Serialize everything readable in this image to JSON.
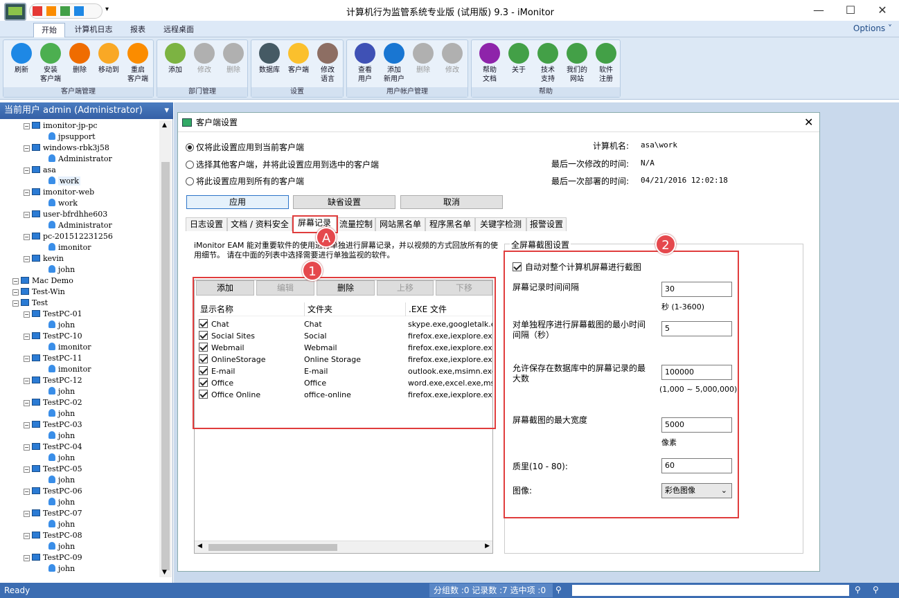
{
  "window": {
    "title": "计算机行为监管系统专业版 (试用版) 9.3 - iMonitor",
    "minimize": "—",
    "maximize": "☐",
    "close": "✕"
  },
  "ribbon_tabs": [
    "开始",
    "计算机日志",
    "报表",
    "远程桌面"
  ],
  "options_label": "Options ˅",
  "groups": [
    {
      "title": "客户端管理",
      "buttons": [
        {
          "label": "刷新",
          "icon": "refresh-icon",
          "color": "#1e88e5"
        },
        {
          "label": "安装\n客户端",
          "icon": "install-client-icon",
          "color": "#4caf50"
        },
        {
          "label": "删除",
          "icon": "delete-x-icon",
          "color": "#ef6c00"
        },
        {
          "label": "移动到",
          "icon": "move-folder-icon",
          "color": "#f9a825"
        },
        {
          "label": "重启\n客户端",
          "icon": "restart-icon",
          "color": "#fb8c00"
        }
      ]
    },
    {
      "title": "部门管理",
      "buttons": [
        {
          "label": "添加",
          "icon": "add-plus-icon",
          "color": "#7cb342"
        },
        {
          "label": "修改",
          "icon": "edit-icon",
          "color": "#b0b0b0",
          "disabled": true
        },
        {
          "label": "删除",
          "icon": "delete-x-icon",
          "color": "#b0b0b0",
          "disabled": true
        }
      ]
    },
    {
      "title": "设置",
      "buttons": [
        {
          "label": "数据库",
          "icon": "database-icon",
          "color": "#455a64"
        },
        {
          "label": "客户端",
          "icon": "client-settings-icon",
          "color": "#fbc02d"
        },
        {
          "label": "修改\n语言",
          "icon": "language-icon",
          "color": "#8d6e63"
        }
      ]
    },
    {
      "title": "用户帐户管理",
      "buttons": [
        {
          "label": "查看\n用户",
          "icon": "view-users-icon",
          "color": "#3f51b5"
        },
        {
          "label": "添加\n新用户",
          "icon": "add-user-icon",
          "color": "#1976d2"
        },
        {
          "label": "删除",
          "icon": "delete-user-icon",
          "color": "#b0b0b0",
          "disabled": true
        },
        {
          "label": "修改",
          "icon": "edit-user-icon",
          "color": "#b0b0b0",
          "disabled": true
        }
      ]
    },
    {
      "title": "帮助",
      "buttons": [
        {
          "label": "帮助\n文档",
          "icon": "help-icon",
          "color": "#8e24aa"
        },
        {
          "label": "关于",
          "icon": "about-icon",
          "color": "#43a047"
        },
        {
          "label": "技术\n支持",
          "icon": "support-icon",
          "color": "#43a047"
        },
        {
          "label": "我们的\n网站",
          "icon": "website-icon",
          "color": "#43a047"
        },
        {
          "label": "软件\n注册",
          "icon": "register-icon",
          "color": "#43a047"
        }
      ]
    }
  ],
  "left_pane": {
    "header": "当前用户 admin (Administrator)",
    "tree": [
      {
        "label": "imonitor-jp-pc",
        "type": "pc",
        "level": 1
      },
      {
        "label": "jpsupport",
        "type": "user",
        "level": 2
      },
      {
        "label": "windows-rbk3j58",
        "type": "pc",
        "level": 1
      },
      {
        "label": "Administrator",
        "type": "user",
        "level": 2
      },
      {
        "label": "asa",
        "type": "pc",
        "level": 1
      },
      {
        "label": "work",
        "type": "user",
        "level": 2,
        "selected": true
      },
      {
        "label": "imonitor-web",
        "type": "pc",
        "level": 1
      },
      {
        "label": "work",
        "type": "user",
        "level": 2
      },
      {
        "label": "user-bfrdhhe603",
        "type": "pc",
        "level": 1
      },
      {
        "label": "Administrator",
        "type": "user",
        "level": 2
      },
      {
        "label": "pc-201512231256",
        "type": "pc",
        "level": 1
      },
      {
        "label": "imonitor",
        "type": "user",
        "level": 2
      },
      {
        "label": "kevin",
        "type": "pc",
        "level": 1
      },
      {
        "label": "john",
        "type": "user",
        "level": 2
      },
      {
        "label": "Mac Demo",
        "type": "group",
        "level": 0
      },
      {
        "label": "Test-Win",
        "type": "group",
        "level": 0
      },
      {
        "label": "Test",
        "type": "group",
        "level": 0
      },
      {
        "label": "TestPC-01",
        "type": "pc",
        "level": 1
      },
      {
        "label": "john",
        "type": "user",
        "level": 2
      },
      {
        "label": "TestPC-10",
        "type": "pc",
        "level": 1
      },
      {
        "label": "imonitor",
        "type": "user",
        "level": 2
      },
      {
        "label": "TestPC-11",
        "type": "pc",
        "level": 1
      },
      {
        "label": "imonitor",
        "type": "user",
        "level": 2
      },
      {
        "label": "TestPC-12",
        "type": "pc",
        "level": 1
      },
      {
        "label": "john",
        "type": "user",
        "level": 2
      },
      {
        "label": "TestPC-02",
        "type": "pc",
        "level": 1
      },
      {
        "label": "john",
        "type": "user",
        "level": 2
      },
      {
        "label": "TestPC-03",
        "type": "pc",
        "level": 1
      },
      {
        "label": "john",
        "type": "user",
        "level": 2
      },
      {
        "label": "TestPC-04",
        "type": "pc",
        "level": 1
      },
      {
        "label": "john",
        "type": "user",
        "level": 2
      },
      {
        "label": "TestPC-05",
        "type": "pc",
        "level": 1
      },
      {
        "label": "john",
        "type": "user",
        "level": 2
      },
      {
        "label": "TestPC-06",
        "type": "pc",
        "level": 1
      },
      {
        "label": "john",
        "type": "user",
        "level": 2
      },
      {
        "label": "TestPC-07",
        "type": "pc",
        "level": 1
      },
      {
        "label": "john",
        "type": "user",
        "level": 2
      },
      {
        "label": "TestPC-08",
        "type": "pc",
        "level": 1
      },
      {
        "label": "john",
        "type": "user",
        "level": 2
      },
      {
        "label": "TestPC-09",
        "type": "pc",
        "level": 1
      },
      {
        "label": "john",
        "type": "user",
        "level": 2
      }
    ]
  },
  "dialog": {
    "title": "客户端设置",
    "radios": [
      {
        "label": "仅将此设置应用到当前客户端",
        "checked": true
      },
      {
        "label": "选择其他客户端，并将此设置应用到选中的客户端",
        "checked": false
      },
      {
        "label": "将此设置应用到所有的客户端",
        "checked": false
      }
    ],
    "info": [
      {
        "label": "计算机名:",
        "value": "asa\\work"
      },
      {
        "label": "最后一次修改的时间:",
        "value": "N/A"
      },
      {
        "label": "最后一次部署的时间:",
        "value": "04/21/2016 12:02:18"
      }
    ],
    "apply": "应用",
    "defaults": "缺省设置",
    "cancel": "取消",
    "tabs": [
      "日志设置",
      "文档 / 资料安全",
      "屏幕记录",
      "流量控制",
      "网站黑名单",
      "程序黑名单",
      "关键字检测",
      "报警设置"
    ],
    "description": "iMonitor EAM 能对重要软件的使用进行单独进行屏幕记录，并以视频的方式回放所有的使用细节。 请在中面的列表中选择需要进行单独监视的软件。",
    "list_buttons": [
      {
        "label": "添加",
        "disabled": false
      },
      {
        "label": "编辑",
        "disabled": true
      },
      {
        "label": "删除",
        "disabled": false
      },
      {
        "label": "上移",
        "disabled": true
      },
      {
        "label": "下移",
        "disabled": true
      }
    ],
    "columns": [
      "显示名称",
      "文件夹",
      ".EXE 文件"
    ],
    "rows": [
      [
        "Chat",
        "Chat",
        "skype.exe,googletalk.exe,"
      ],
      [
        "Social Sites",
        "Social",
        "firefox.exe,iexplore.exe,ch"
      ],
      [
        "Webmail",
        "Webmail",
        "firefox.exe,iexplore.exe,ch"
      ],
      [
        "OnlineStorage",
        "Online Storage",
        "firefox.exe,iexplore.exe,ch"
      ],
      [
        "E-mail",
        "E-mail",
        "outlook.exe,msimn.exe,thu"
      ],
      [
        "Office",
        "Office",
        "word.exe,excel.exe,msacc"
      ],
      [
        "Office Online",
        "office-online",
        "firefox.exe,iexplore.exe,ch"
      ]
    ],
    "fullscreen": {
      "title": "全屏幕截图设置",
      "auto_label": "自动对整个计算机屏幕进行截图",
      "interval_label": "屏幕记录时间间隔",
      "interval_value": "30",
      "interval_hint": "秒 (1-3600)",
      "min_interval_label": "对单独程序进行屏幕截图的最小时间间隔（秒）",
      "min_interval_value": "5",
      "max_records_label": "允许保存在数据库中的屏幕记录的最大数",
      "max_records_value": "100000",
      "max_records_hint": "(1,000 ~ 5,000,000)",
      "max_width_label": "屏幕截图的最大宽度",
      "max_width_value": "5000",
      "max_width_hint": "像素",
      "quality_label": "质里(10 - 80):",
      "quality_value": "60",
      "image_label": "图像:",
      "image_value": "彩色图像"
    }
  },
  "annotations": {
    "a": "A",
    "one": "1",
    "two": "2"
  },
  "statusbar": {
    "left": "Ready",
    "mid": "分组数 :0  记录数 :7  选中项 :0"
  }
}
